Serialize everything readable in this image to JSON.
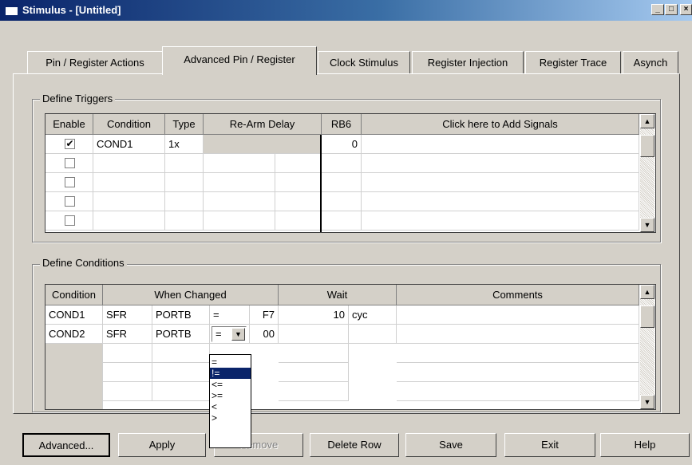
{
  "window": {
    "title": "Stimulus - [Untitled]",
    "controls": [
      "_",
      "□",
      "×"
    ]
  },
  "tabs": [
    "Pin / Register Actions",
    "Advanced Pin / Register",
    "Clock Stimulus",
    "Register Injection",
    "Register Trace",
    "Asynch"
  ],
  "active_tab": "Advanced Pin / Register",
  "triggers": {
    "legend": "Define Triggers",
    "headers": [
      "Enable",
      "Condition",
      "Type",
      "Re-Arm Delay",
      "RB6",
      "Click here to Add Signals"
    ],
    "rows": [
      {
        "enabled": true,
        "condition": "COND1",
        "type": "1x",
        "rb6": "0"
      },
      {
        "enabled": false,
        "condition": "",
        "type": "",
        "rb6": ""
      },
      {
        "enabled": false,
        "condition": "",
        "type": "",
        "rb6": ""
      },
      {
        "enabled": false,
        "condition": "",
        "type": "",
        "rb6": ""
      }
    ]
  },
  "conditions": {
    "legend": "Define Conditions",
    "headers": [
      "Condition",
      "When Changed",
      "Wait",
      "Comments"
    ],
    "rows": [
      {
        "condition": "COND1",
        "type": "SFR",
        "register": "PORTB",
        "op": "=",
        "value": "F7",
        "wait": "10",
        "unit": "cyc",
        "comment": ""
      },
      {
        "condition": "COND2",
        "type": "SFR",
        "register": "PORTB",
        "op": "=",
        "value": "00",
        "wait": "",
        "unit": "",
        "comment": ""
      }
    ],
    "dropdown_options": [
      "=",
      "!=",
      "<=",
      ">=",
      "<",
      ">"
    ],
    "dropdown_selected": "!="
  },
  "buttons": {
    "advanced": "Advanced...",
    "apply": "Apply",
    "remove": "Remove",
    "delete_row": "Delete Row",
    "save": "Save",
    "exit": "Exit",
    "help": "Help"
  },
  "colors": {
    "title_bar": "#0a246a",
    "face": "#d4d0c8",
    "selection": "#0a246a"
  }
}
